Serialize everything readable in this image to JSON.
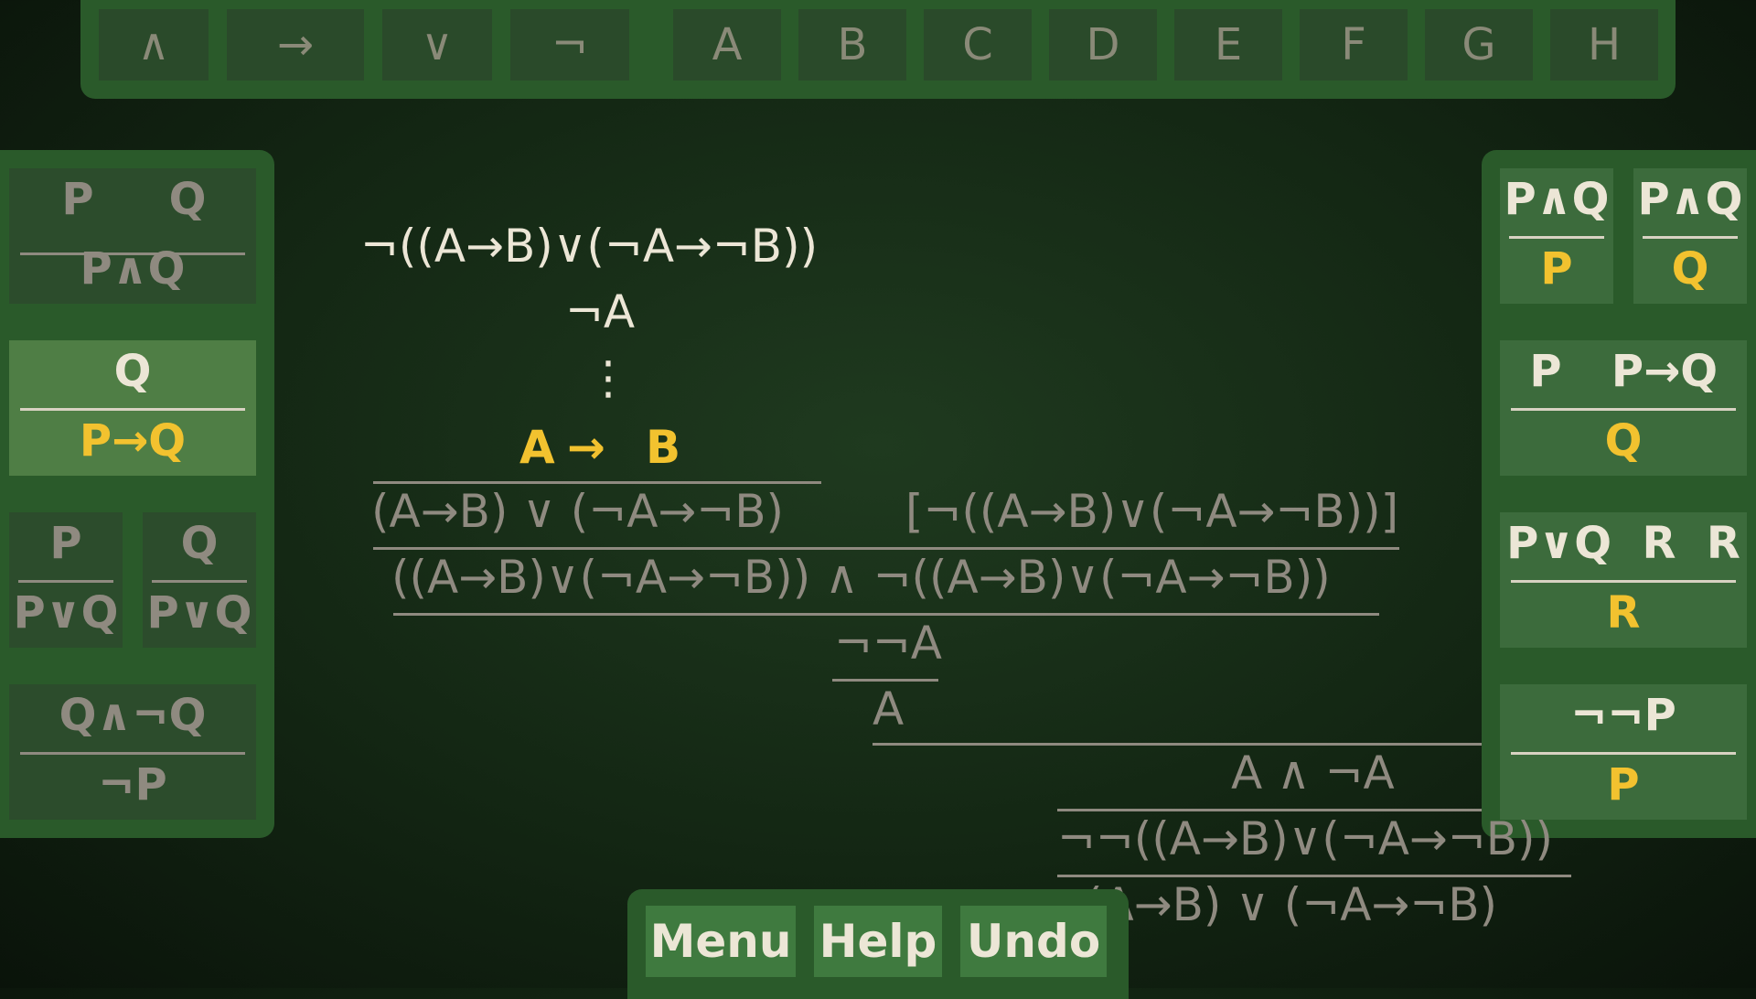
{
  "top_keys": [
    "∧",
    "→",
    "∨",
    "¬",
    "A",
    "B",
    "C",
    "D",
    "E",
    "F",
    "G",
    "H"
  ],
  "left_rules": [
    {
      "top_left": "P",
      "top_right": "Q",
      "bottom": "P∧Q"
    },
    {
      "top": "Q",
      "bottom": "P→Q"
    },
    {
      "top": "P",
      "bottom": "P∨Q"
    },
    {
      "top": "Q",
      "bottom": "P∨Q"
    },
    {
      "top": "Q∧¬Q",
      "bottom": "¬P"
    }
  ],
  "right_rules": [
    {
      "top": "P∧Q",
      "bottom": "P"
    },
    {
      "top": "P∧Q",
      "bottom": "Q"
    },
    {
      "top_left": "P",
      "top_right": "P→Q",
      "bottom": "Q"
    },
    {
      "top": "P∨Q  R  R",
      "bottom": "R"
    },
    {
      "top": "¬¬P",
      "bottom": "P"
    }
  ],
  "board": {
    "goal": "¬((A→B)∨(¬A→¬B))",
    "assume": "¬A",
    "dots": "⋮",
    "target_left": "A",
    "target_arrow": "→",
    "target_right": "B",
    "l_disj": "(A→B) ∨ (¬A→¬B)",
    "r_neg": "[¬((A→B)∨(¬A→¬B))]",
    "conj": "((A→B)∨(¬A→¬B)) ∧ ¬((A→B)∨(¬A→¬B))",
    "dneg": "¬¬A",
    "a": "A",
    "contra": "A ∧ ¬A",
    "ddneg": "¬¬((A→B)∨(¬A→¬B))",
    "final": "(A→B) ∨ (¬A→¬B)"
  },
  "buttons": {
    "menu": "Menu",
    "help": "Help",
    "undo": "Undo"
  }
}
